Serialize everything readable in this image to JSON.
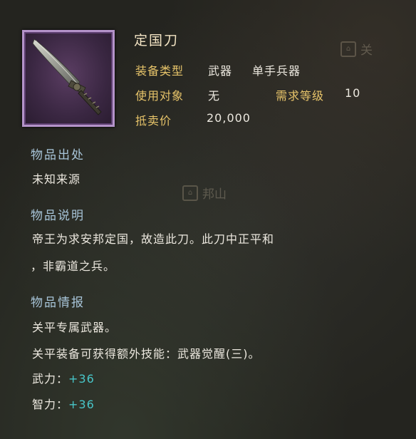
{
  "item": {
    "name": "定国刀",
    "icon": "blade-icon",
    "type_label": "装备类型",
    "type_value1": "武器",
    "type_value2": "单手兵器",
    "user_label": "使用对象",
    "user_value": "无",
    "level_label": "需求等级",
    "level_value": "10",
    "price_label": "抵卖价",
    "price_value": "20,000"
  },
  "sections": {
    "origin_title": "物品出处",
    "origin_text": "未知来源",
    "desc_title": "物品说明",
    "desc_line1": "帝王为求安邦定国，故造此刀。此刀中正平和",
    "desc_line2": "，非霸道之兵。",
    "info_title": "物品情报",
    "info_line1": "关平专属武器。",
    "info_line2": "关平装备可获得额外技能：武器觉醒(三)。",
    "stat1_label": "武力：",
    "stat1_value": "+36",
    "stat2_label": "智力：",
    "stat2_value": "+36"
  },
  "background": {
    "marker1": "关",
    "marker2": "邦山"
  },
  "colors": {
    "label_gold": "#e7c46a",
    "heading_blue": "#a7c4d8",
    "bonus_cyan": "#48c6c9",
    "frame_purple": "#b493c9"
  }
}
